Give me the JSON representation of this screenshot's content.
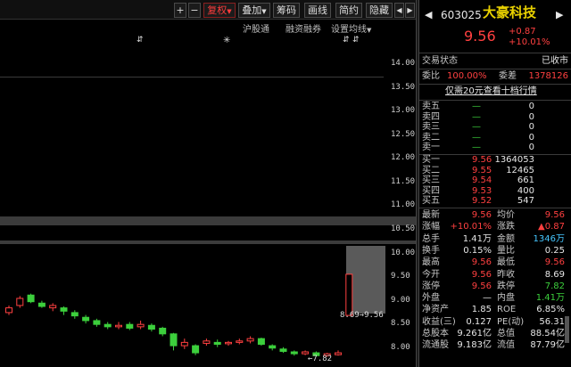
{
  "toolbar": {
    "plus": "+",
    "minus": "−",
    "fuquan": "复权",
    "diejia": "叠加",
    "choumA": "筹码",
    "huaxian": "画线",
    "jianyue": "简约",
    "yincang": "隐藏",
    "left_arrow": "◀",
    "right_arrow": "▶"
  },
  "subbar": {
    "hugutong": "沪股通",
    "rongzi": "融资融券",
    "settings": "设置均线"
  },
  "axis": {
    "ticks": [
      "14.00",
      "13.50",
      "13.00",
      "12.50",
      "12.00",
      "11.50",
      "11.00",
      "10.50",
      "10.00",
      "9.50",
      "9.00",
      "8.50",
      "8.00"
    ]
  },
  "annotations": {
    "high_label": "8.69→9.56",
    "low_label": "←7.82"
  },
  "stock": {
    "code": "603025",
    "name": "大豪科技",
    "price": "9.56",
    "change": "+0.87",
    "change_pct": "+10.01%"
  },
  "status": {
    "state_label": "交易状态",
    "state_value": "已收市",
    "ratio_label": "委比",
    "ratio_value": "100.00%",
    "diff_label": "委差",
    "diff_value": "1378126",
    "level2_link": "仅需20元查看十档行情"
  },
  "asks": [
    {
      "label": "卖五",
      "price": "—",
      "vol": "0"
    },
    {
      "label": "卖四",
      "price": "—",
      "vol": "0"
    },
    {
      "label": "卖三",
      "price": "—",
      "vol": "0"
    },
    {
      "label": "卖二",
      "price": "—",
      "vol": "0"
    },
    {
      "label": "卖一",
      "price": "—",
      "vol": "0"
    }
  ],
  "bids": [
    {
      "label": "买一",
      "price": "9.56",
      "vol": "1364053"
    },
    {
      "label": "买二",
      "price": "9.55",
      "vol": "12465"
    },
    {
      "label": "买三",
      "price": "9.54",
      "vol": "661"
    },
    {
      "label": "买四",
      "price": "9.53",
      "vol": "400"
    },
    {
      "label": "买五",
      "price": "9.52",
      "vol": "547"
    }
  ],
  "quotes": [
    {
      "l1": "最新",
      "v1": "9.56",
      "c1": "red",
      "l2": "均价",
      "v2": "9.56",
      "c2": "red"
    },
    {
      "l1": "涨幅",
      "v1": "+10.01%",
      "c1": "red",
      "l2": "涨跌",
      "v2": "▲0.87",
      "c2": "red"
    },
    {
      "l1": "总手",
      "v1": "1.41万",
      "c1": "white",
      "l2": "金额",
      "v2": "1346万",
      "c2": "cyan"
    },
    {
      "l1": "换手",
      "v1": "0.15%",
      "c1": "white",
      "l2": "量比",
      "v2": "0.25",
      "c2": "white"
    },
    {
      "l1": "最高",
      "v1": "9.56",
      "c1": "red",
      "l2": "最低",
      "v2": "9.56",
      "c2": "red"
    },
    {
      "l1": "今开",
      "v1": "9.56",
      "c1": "red",
      "l2": "昨收",
      "v2": "8.69",
      "c2": "white"
    },
    {
      "l1": "涨停",
      "v1": "9.56",
      "c1": "red",
      "l2": "跌停",
      "v2": "7.82",
      "c2": "green"
    },
    {
      "l1": "外盘",
      "v1": "—",
      "c1": "white",
      "l2": "内盘",
      "v2": "1.41万",
      "c2": "green"
    },
    {
      "l1": "净资产",
      "v1": "1.85",
      "c1": "white",
      "l2": "ROE",
      "v2": "6.85%",
      "c2": "white"
    },
    {
      "l1": "收益(三)",
      "v1": "0.127",
      "c1": "white",
      "l2": "PE(动)",
      "v2": "56.31",
      "c2": "white"
    },
    {
      "l1": "总股本",
      "v1": "9.261亿",
      "c1": "white",
      "l2": "总值",
      "v2": "88.54亿",
      "c2": "white"
    },
    {
      "l1": "流通股",
      "v1": "9.183亿",
      "c1": "white",
      "l2": "流值",
      "v2": "87.79亿",
      "c2": "white"
    }
  ],
  "colors": {
    "up": "#ff4040",
    "down": "#3ccf3c"
  },
  "chart_data": {
    "type": "candlestick",
    "ylim": [
      7.6,
      14.2
    ],
    "candles": [
      {
        "o": 8.75,
        "c": 8.85,
        "h": 8.9,
        "l": 8.7
      },
      {
        "o": 8.9,
        "c": 9.05,
        "h": 9.1,
        "l": 8.85
      },
      {
        "o": 9.12,
        "c": 8.98,
        "h": 9.15,
        "l": 8.95
      },
      {
        "o": 8.95,
        "c": 8.88,
        "h": 9.0,
        "l": 8.85
      },
      {
        "o": 8.85,
        "c": 8.9,
        "h": 8.95,
        "l": 8.78
      },
      {
        "o": 8.85,
        "c": 8.78,
        "h": 8.88,
        "l": 8.7
      },
      {
        "o": 8.75,
        "c": 8.68,
        "h": 8.8,
        "l": 8.62
      },
      {
        "o": 8.65,
        "c": 8.58,
        "h": 8.7,
        "l": 8.52
      },
      {
        "o": 8.58,
        "c": 8.5,
        "h": 8.62,
        "l": 8.45
      },
      {
        "o": 8.5,
        "c": 8.45,
        "h": 8.55,
        "l": 8.4
      },
      {
        "o": 8.45,
        "c": 8.48,
        "h": 8.55,
        "l": 8.4
      },
      {
        "o": 8.5,
        "c": 8.42,
        "h": 8.55,
        "l": 8.38
      },
      {
        "o": 8.45,
        "c": 8.5,
        "h": 8.58,
        "l": 8.4
      },
      {
        "o": 8.48,
        "c": 8.4,
        "h": 8.52,
        "l": 8.35
      },
      {
        "o": 8.42,
        "c": 8.3,
        "h": 8.45,
        "l": 8.25
      },
      {
        "o": 8.3,
        "c": 8.05,
        "h": 8.32,
        "l": 7.95
      },
      {
        "o": 8.05,
        "c": 8.12,
        "h": 8.2,
        "l": 7.98
      },
      {
        "o": 8.05,
        "c": 7.9,
        "h": 8.08,
        "l": 7.85
      },
      {
        "o": 8.1,
        "c": 8.15,
        "h": 8.2,
        "l": 8.05
      },
      {
        "o": 8.12,
        "c": 8.08,
        "h": 8.18,
        "l": 8.02
      },
      {
        "o": 8.1,
        "c": 8.12,
        "h": 8.15,
        "l": 8.05
      },
      {
        "o": 8.12,
        "c": 8.15,
        "h": 8.2,
        "l": 8.08
      },
      {
        "o": 8.15,
        "c": 8.2,
        "h": 8.25,
        "l": 8.1
      },
      {
        "o": 8.2,
        "c": 8.08,
        "h": 8.22,
        "l": 8.05
      },
      {
        "o": 8.05,
        "c": 8.0,
        "h": 8.08,
        "l": 7.95
      },
      {
        "o": 7.98,
        "c": 7.93,
        "h": 8.02,
        "l": 7.9
      },
      {
        "o": 7.92,
        "c": 7.88,
        "h": 7.95,
        "l": 7.84
      },
      {
        "o": 7.88,
        "c": 7.92,
        "h": 7.95,
        "l": 7.85
      },
      {
        "o": 7.9,
        "c": 7.84,
        "h": 7.93,
        "l": 7.82
      },
      {
        "o": 7.84,
        "c": 7.88,
        "h": 7.9,
        "l": 7.82
      },
      {
        "o": 7.86,
        "c": 7.9,
        "h": 7.95,
        "l": 7.84
      },
      {
        "o": 8.69,
        "c": 9.56,
        "h": 9.56,
        "l": 8.69
      }
    ]
  }
}
